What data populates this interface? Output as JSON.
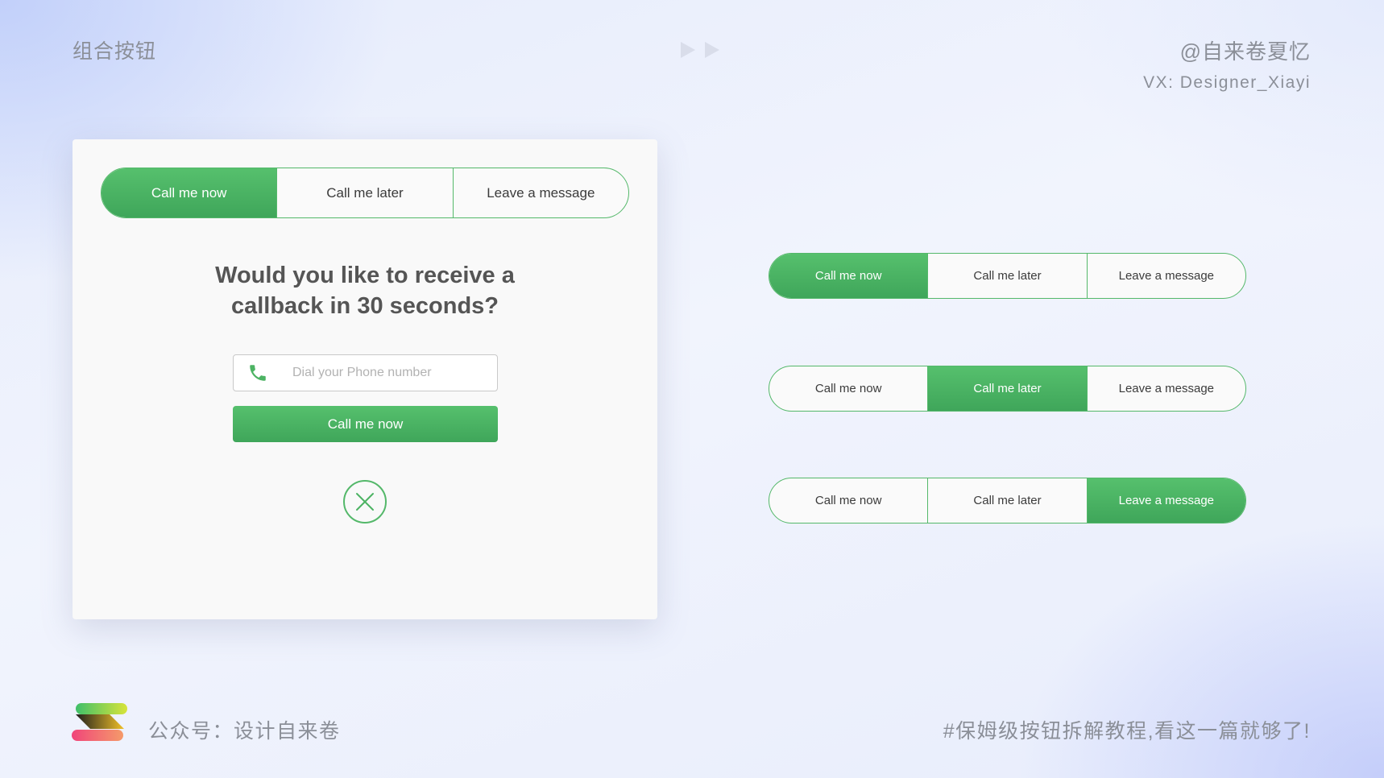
{
  "header": {
    "title": "组合按钮",
    "author": "@自来卷夏忆",
    "wechat": "VX: Designer_Xiayi"
  },
  "card": {
    "tabs": [
      {
        "label": "Call me now",
        "active": true
      },
      {
        "label": "Call me later",
        "active": false
      },
      {
        "label": "Leave a message",
        "active": false
      }
    ],
    "question_line1": "Would you like to receive a",
    "question_line2": "callback in 30 seconds?",
    "phone_placeholder": "Dial your Phone number",
    "submit_label": "Call me now",
    "phone_icon": "phone-icon",
    "close_icon": "close-icon"
  },
  "variants": [
    {
      "options": [
        "Call me now",
        "Call me later",
        "Leave a message"
      ],
      "active_index": 0
    },
    {
      "options": [
        "Call me now",
        "Call me later",
        "Leave a message"
      ],
      "active_index": 1
    },
    {
      "options": [
        "Call me now",
        "Call me later",
        "Leave a message"
      ],
      "active_index": 2
    }
  ],
  "footer": {
    "left": "公众号：设计自来卷",
    "right": "#保姆级按钮拆解教程,看这一篇就够了!"
  },
  "colors": {
    "accent": "#4cb363",
    "accent_dark": "#3fa65a",
    "text_muted": "#8b8f98"
  }
}
